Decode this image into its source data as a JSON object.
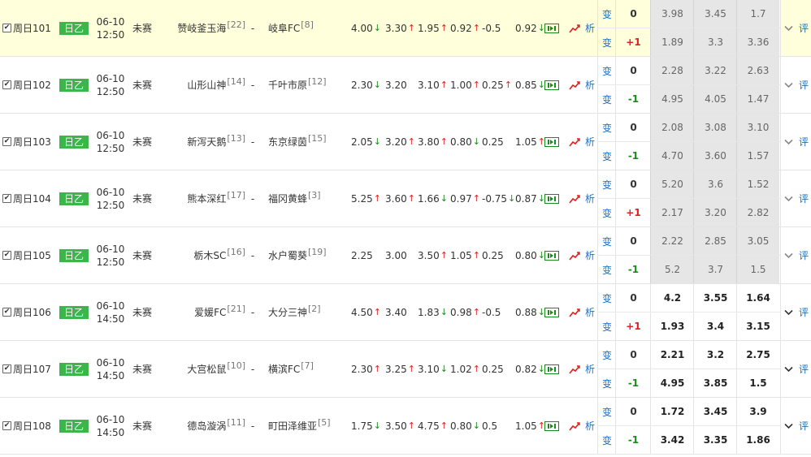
{
  "colors": {
    "league_bg": "#3cb54a",
    "up": "#e02020",
    "down": "#1a8a1a",
    "link": "#1a6fc4",
    "highlight_row": "#ffffdc",
    "grey_cell": "#e6e6e6"
  },
  "labels": {
    "league": "日乙",
    "status": "未赛",
    "dash": "-",
    "bian": "变",
    "analysis": "析",
    "ping": "评"
  },
  "icons": {
    "checkbox": "checked-checkbox-icon",
    "live": "live-video-icon",
    "trend": "trend-chart-icon",
    "expand": "chevron-down-icon"
  },
  "matches": [
    {
      "id": "周日101",
      "date": "06-10",
      "time": "12:50",
      "home": "赞岐釜玉海",
      "home_rank": "[22]",
      "away": "岐阜FC",
      "away_rank": "[8]",
      "odds": [
        {
          "v": "4.00",
          "d": "dn"
        },
        {
          "v": "3.30",
          "d": "up"
        },
        {
          "v": "1.95",
          "d": "up"
        },
        {
          "v": "0.92",
          "d": "up"
        },
        {
          "v": "-0.5",
          "d": ""
        },
        {
          "v": "0.92",
          "d": "dn"
        }
      ],
      "hc_top": "0",
      "hc_bot": "+1",
      "hc_bot_color": "red",
      "top": [
        "3.98",
        "3.45",
        "1.7"
      ],
      "bot": [
        "1.89",
        "3.3",
        "3.36"
      ],
      "grey": true
    },
    {
      "id": "周日102",
      "date": "06-10",
      "time": "12:50",
      "home": "山形山神",
      "home_rank": "[14]",
      "away": "千叶市原",
      "away_rank": "[12]",
      "odds": [
        {
          "v": "2.30",
          "d": "dn"
        },
        {
          "v": "3.20",
          "d": ""
        },
        {
          "v": "3.10",
          "d": "up"
        },
        {
          "v": "1.00",
          "d": "up"
        },
        {
          "v": "0.25",
          "d": "up"
        },
        {
          "v": "0.85",
          "d": "dn"
        }
      ],
      "hc_top": "0",
      "hc_bot": "-1",
      "hc_bot_color": "green",
      "top": [
        "2.28",
        "3.22",
        "2.63"
      ],
      "bot": [
        "4.95",
        "4.05",
        "1.47"
      ],
      "grey": true
    },
    {
      "id": "周日103",
      "date": "06-10",
      "time": "12:50",
      "home": "新泻天鹅",
      "home_rank": "[13]",
      "away": "东京绿茵",
      "away_rank": "[15]",
      "odds": [
        {
          "v": "2.05",
          "d": "dn"
        },
        {
          "v": "3.20",
          "d": "up"
        },
        {
          "v": "3.80",
          "d": "up"
        },
        {
          "v": "0.80",
          "d": "dn"
        },
        {
          "v": "0.25",
          "d": ""
        },
        {
          "v": "1.05",
          "d": "up"
        }
      ],
      "hc_top": "0",
      "hc_bot": "-1",
      "hc_bot_color": "green",
      "top": [
        "2.08",
        "3.08",
        "3.10"
      ],
      "bot": [
        "4.70",
        "3.60",
        "1.57"
      ],
      "grey": true
    },
    {
      "id": "周日104",
      "date": "06-10",
      "time": "12:50",
      "home": "熊本深红",
      "home_rank": "[17]",
      "away": "福冈黄蜂",
      "away_rank": "[3]",
      "odds": [
        {
          "v": "5.25",
          "d": "up"
        },
        {
          "v": "3.60",
          "d": "up"
        },
        {
          "v": "1.66",
          "d": "dn"
        },
        {
          "v": "0.97",
          "d": "up"
        },
        {
          "v": "-0.75",
          "d": "dn"
        },
        {
          "v": "0.87",
          "d": "dn"
        }
      ],
      "hc_top": "0",
      "hc_bot": "+1",
      "hc_bot_color": "red",
      "top": [
        "5.20",
        "3.6",
        "1.52"
      ],
      "bot": [
        "2.17",
        "3.20",
        "2.82"
      ],
      "grey": true
    },
    {
      "id": "周日105",
      "date": "06-10",
      "time": "12:50",
      "home": "栃木SC",
      "home_rank": "[16]",
      "away": "水户蜀葵",
      "away_rank": "[19]",
      "odds": [
        {
          "v": "2.25",
          "d": ""
        },
        {
          "v": "3.00",
          "d": ""
        },
        {
          "v": "3.50",
          "d": "up"
        },
        {
          "v": "1.05",
          "d": "up"
        },
        {
          "v": "0.25",
          "d": ""
        },
        {
          "v": "0.80",
          "d": "dn"
        }
      ],
      "hc_top": "0",
      "hc_bot": "-1",
      "hc_bot_color": "green",
      "top": [
        "2.22",
        "2.85",
        "3.05"
      ],
      "bot": [
        "5.2",
        "3.7",
        "1.5"
      ],
      "grey": true
    },
    {
      "id": "周日106",
      "date": "06-10",
      "time": "14:50",
      "home": "爱媛FC",
      "home_rank": "[21]",
      "away": "大分三神",
      "away_rank": "[2]",
      "odds": [
        {
          "v": "4.50",
          "d": "up"
        },
        {
          "v": "3.40",
          "d": ""
        },
        {
          "v": "1.83",
          "d": "dn"
        },
        {
          "v": "0.98",
          "d": "up"
        },
        {
          "v": "-0.5",
          "d": ""
        },
        {
          "v": "0.88",
          "d": "dn"
        }
      ],
      "hc_top": "0",
      "hc_bot": "+1",
      "hc_bot_color": "red",
      "top": [
        "4.2",
        "3.55",
        "1.64"
      ],
      "bot": [
        "1.93",
        "3.4",
        "3.15"
      ],
      "grey": false
    },
    {
      "id": "周日107",
      "date": "06-10",
      "time": "14:50",
      "home": "大宫松鼠",
      "home_rank": "[10]",
      "away": "横滨FC",
      "away_rank": "[7]",
      "odds": [
        {
          "v": "2.30",
          "d": "up"
        },
        {
          "v": "3.25",
          "d": "up"
        },
        {
          "v": "3.10",
          "d": "dn"
        },
        {
          "v": "1.02",
          "d": "up"
        },
        {
          "v": "0.25",
          "d": ""
        },
        {
          "v": "0.82",
          "d": "dn"
        }
      ],
      "hc_top": "0",
      "hc_bot": "-1",
      "hc_bot_color": "green",
      "top": [
        "2.21",
        "3.2",
        "2.75"
      ],
      "bot": [
        "4.95",
        "3.85",
        "1.5"
      ],
      "grey": false
    },
    {
      "id": "周日108",
      "date": "06-10",
      "time": "14:50",
      "home": "德岛漩涡",
      "home_rank": "[11]",
      "away": "町田泽维亚",
      "away_rank": "[5]",
      "odds": [
        {
          "v": "1.75",
          "d": "dn"
        },
        {
          "v": "3.50",
          "d": "up"
        },
        {
          "v": "4.75",
          "d": "up"
        },
        {
          "v": "0.80",
          "d": "dn"
        },
        {
          "v": "0.5",
          "d": ""
        },
        {
          "v": "1.05",
          "d": "up"
        }
      ],
      "hc_top": "0",
      "hc_bot": "-1",
      "hc_bot_color": "green",
      "top": [
        "1.72",
        "3.45",
        "3.9"
      ],
      "bot": [
        "3.42",
        "3.35",
        "1.86"
      ],
      "grey": false
    }
  ]
}
